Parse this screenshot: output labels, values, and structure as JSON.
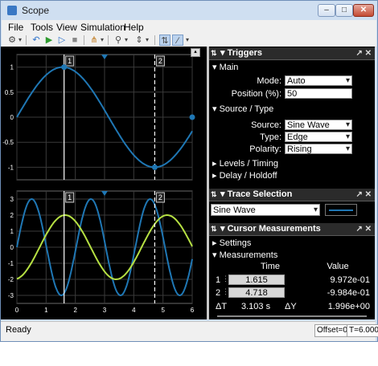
{
  "window": {
    "title": "Scope"
  },
  "menu": [
    "File",
    "Tools",
    "View",
    "Simulation",
    "Help"
  ],
  "plot1": {
    "yticks": [
      "1",
      "0.5",
      "0",
      "-0.5",
      "-1"
    ],
    "xticks": [
      "0",
      "1",
      "2",
      "3",
      "4",
      "5",
      "6"
    ],
    "cursor1_label": "1",
    "cursor2_label": "2"
  },
  "plot2": {
    "yticks": [
      "3",
      "2",
      "1",
      "0",
      "-1",
      "-2",
      "-3"
    ],
    "xticks": [
      "0",
      "1",
      "2",
      "3",
      "4",
      "5",
      "6"
    ],
    "cursor1_label": "1",
    "cursor2_label": "2"
  },
  "chart_data": [
    {
      "type": "line",
      "title": "",
      "series": [
        {
          "name": "Sine Wave",
          "color": "#1f77b4",
          "function": "sin(t)"
        }
      ],
      "xlim": [
        0,
        6
      ],
      "ylim": [
        -1.25,
        1.25
      ],
      "grid": true,
      "cursors": [
        1.615,
        4.718
      ]
    },
    {
      "type": "line",
      "title": "",
      "series": [
        {
          "color": "#1f77b4",
          "function": "3*sin(3.1*t)"
        },
        {
          "color": "#b6e043",
          "function": "2*sin(1.8*t - 1.4)"
        }
      ],
      "xlim": [
        0,
        6
      ],
      "ylim": [
        -3.5,
        3.5
      ],
      "grid": true,
      "cursors": [
        1.615,
        4.718
      ]
    }
  ],
  "triggers": {
    "header": "Triggers",
    "main_label": "Main",
    "mode_label": "Mode:",
    "mode_value": "Auto",
    "position_label": "Position (%):",
    "position_value": "50",
    "source_type_label": "Source / Type",
    "source_label": "Source:",
    "source_value": "Sine Wave",
    "type_label": "Type:",
    "type_value": "Edge",
    "polarity_label": "Polarity:",
    "polarity_value": "Rising",
    "levels_label": "Levels / Timing",
    "delay_label": "Delay / Holdoff"
  },
  "trace_selection": {
    "header": "Trace Selection",
    "value": "Sine Wave",
    "color": "#1f77b4"
  },
  "cursor_measurements": {
    "header": "Cursor Measurements",
    "settings_label": "Settings",
    "measurements_label": "Measurements",
    "time_header": "Time",
    "value_header": "Value",
    "row1_label": "1",
    "row1_time": "1.615",
    "row1_value": "9.972e-01",
    "row2_label": "2",
    "row2_time": "4.718",
    "row2_value": "-9.984e-01",
    "dt_label": "ΔT",
    "dt_value": "3.103 s",
    "dy_label": "ΔY",
    "dy_value": "1.996e+00"
  },
  "status": {
    "ready": "Ready",
    "offset": "Offset=0",
    "time": "T=6.000"
  }
}
